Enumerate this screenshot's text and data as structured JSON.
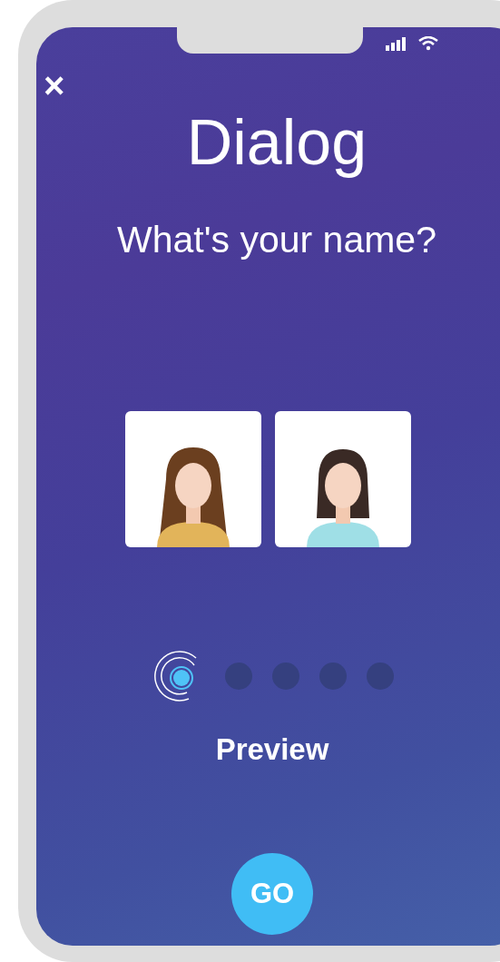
{
  "close": {
    "label": "×"
  },
  "title": "Dialog",
  "question": "What's your name?",
  "avatars": [
    {
      "kind": "long-hair",
      "selected": false
    },
    {
      "kind": "bob",
      "selected": false
    }
  ],
  "steps": [
    {
      "selected": true
    },
    {
      "selected": false
    },
    {
      "selected": false
    },
    {
      "selected": false
    },
    {
      "selected": false
    }
  ],
  "step_label": "Preview",
  "go_button": "GO"
}
